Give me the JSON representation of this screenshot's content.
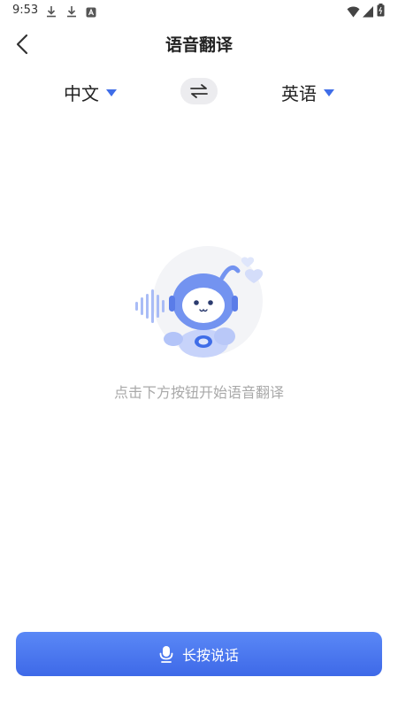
{
  "status_bar": {
    "time": "9:53"
  },
  "header": {
    "title": "语音翻译"
  },
  "languages": {
    "source": "中文",
    "target": "英语"
  },
  "main": {
    "hint": "点击下方按钮开始语音翻译"
  },
  "action": {
    "label": "长按说话"
  },
  "icons": {
    "back": "chevron-left-icon",
    "dropdown": "triangle-down-icon",
    "swap": "swap-arrows-icon",
    "mic": "microphone-icon"
  },
  "colors": {
    "accent": "#3f6de8",
    "hint": "#a9a9a9",
    "swap_bg": "#ececef"
  }
}
